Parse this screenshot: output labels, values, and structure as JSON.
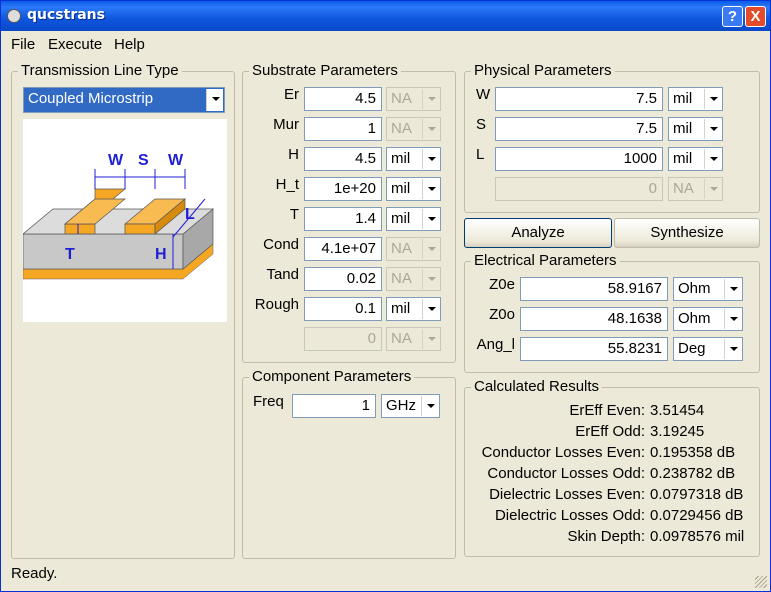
{
  "window": {
    "title": "qucstrans",
    "help_btn": "?",
    "close_btn": "X"
  },
  "menu": {
    "file": "File",
    "execute": "Execute",
    "help": "Help"
  },
  "transmission": {
    "group_title": "Transmission Line Type",
    "selected": "Coupled Microstrip",
    "diagram_labels": {
      "w1": "W",
      "s": "S",
      "w2": "W",
      "l": "L",
      "t": "T",
      "h": "H"
    },
    "colors": {
      "conductor": "#f5a623",
      "substrate": "#c8c8c8",
      "dimension": "#1f1fd6"
    }
  },
  "substrate": {
    "group_title": "Substrate Parameters",
    "rows": [
      {
        "label": "Er",
        "value": "4.5",
        "unit": "NA",
        "enabled": false
      },
      {
        "label": "Mur",
        "value": "1",
        "unit": "NA",
        "enabled": false
      },
      {
        "label": "H",
        "value": "4.5",
        "unit": "mil",
        "enabled": true
      },
      {
        "label": "H_t",
        "value": "1e+20",
        "unit": "mil",
        "enabled": true
      },
      {
        "label": "T",
        "value": "1.4",
        "unit": "mil",
        "enabled": true
      },
      {
        "label": "Cond",
        "value": "4.1e+07",
        "unit": "NA",
        "enabled": false
      },
      {
        "label": "Tand",
        "value": "0.02",
        "unit": "NA",
        "enabled": false
      },
      {
        "label": "Rough",
        "value": "0.1",
        "unit": "mil",
        "enabled": true
      },
      {
        "label": "",
        "value": "0",
        "unit": "NA",
        "enabled": false
      }
    ]
  },
  "component": {
    "group_title": "Component Parameters",
    "freq_label": "Freq",
    "freq_value": "1",
    "freq_unit": "GHz"
  },
  "physical": {
    "group_title": "Physical Parameters",
    "rows": [
      {
        "label": "W",
        "value": "7.5",
        "unit": "mil"
      },
      {
        "label": "S",
        "value": "7.5",
        "unit": "mil"
      },
      {
        "label": "L",
        "value": "1000",
        "unit": "mil"
      },
      {
        "label": "",
        "value": "0",
        "unit": "NA"
      }
    ]
  },
  "buttons": {
    "analyze": "Analyze",
    "synthesize": "Synthesize"
  },
  "electrical": {
    "group_title": "Electrical Parameters",
    "rows": [
      {
        "label": "Z0e",
        "value": "58.9167",
        "unit": "Ohm"
      },
      {
        "label": "Z0o",
        "value": "48.1638",
        "unit": "Ohm"
      },
      {
        "label": "Ang_l",
        "value": "55.8231",
        "unit": "Deg"
      }
    ]
  },
  "results": {
    "group_title": "Calculated Results",
    "rows": [
      {
        "label": "ErEff Even:",
        "value": "3.51454"
      },
      {
        "label": "ErEff Odd:",
        "value": "3.19245"
      },
      {
        "label": "Conductor Losses Even:",
        "value": "0.195358 dB"
      },
      {
        "label": "Conductor Losses Odd:",
        "value": "0.238782 dB"
      },
      {
        "label": "Dielectric Losses Even:",
        "value": "0.0797318 dB"
      },
      {
        "label": "Dielectric Losses Odd:",
        "value": "0.0729456 dB"
      },
      {
        "label": "Skin Depth:",
        "value": "0.0978576 mil"
      }
    ]
  },
  "status": {
    "text": "Ready."
  }
}
